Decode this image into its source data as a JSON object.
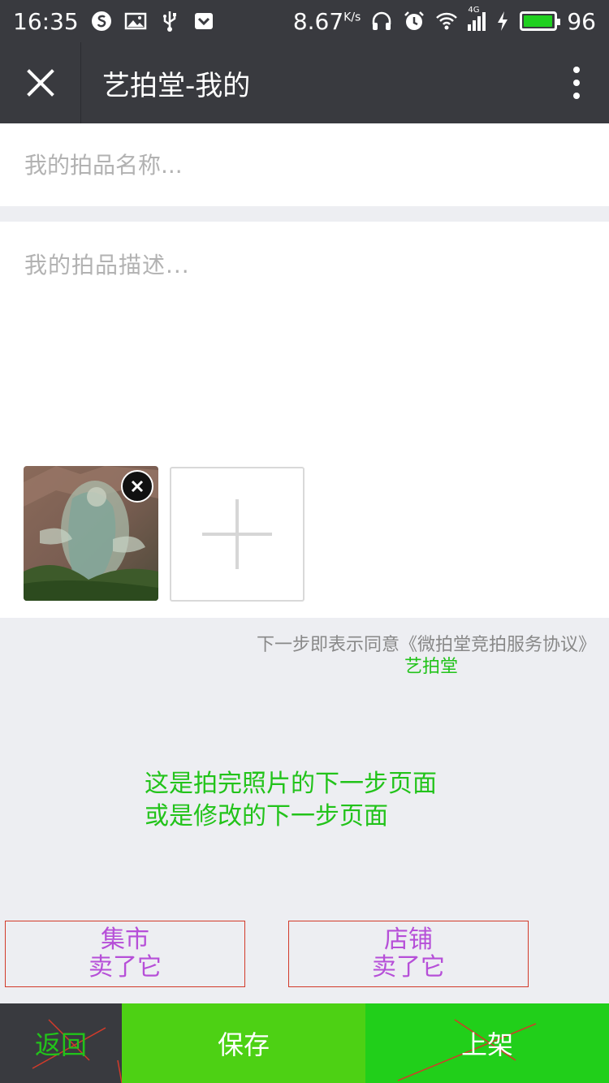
{
  "status_bar": {
    "time": "16:35",
    "speed_value": "8.67",
    "speed_unit": "K/s",
    "network": "4G",
    "battery_level": "96",
    "icons": [
      "s-icon",
      "image-icon",
      "usb-icon",
      "pocket-icon",
      "headphone-icon",
      "alarm-icon",
      "wifi-icon",
      "signal-icon",
      "charging-icon",
      "battery-icon"
    ]
  },
  "nav": {
    "close_icon": "close-icon",
    "title": "艺拍堂-我的",
    "more_icon": "more-vertical-icon"
  },
  "form": {
    "name_placeholder": "我的拍品名称...",
    "description_placeholder": "我的拍品描述...",
    "remove_photo_icon": "close-circle-icon",
    "add_photo_icon": "plus-icon"
  },
  "agreement": {
    "text": "下一步即表示同意《微拍堂竞拍服务协议》",
    "brand_annotation": "艺拍堂"
  },
  "note": {
    "line1": "这是拍完照片的下一步页面",
    "line2": "或是修改的下一步页面"
  },
  "sell_options": [
    {
      "line1": "集市",
      "line2": "卖了它"
    },
    {
      "line1": "店铺",
      "line2": "卖了它"
    }
  ],
  "bottom_bar": {
    "back_label": "返回",
    "save_label": "保存",
    "publish_label": "上架"
  },
  "colors": {
    "nav_bg": "#393a3f",
    "green": "#22c31a",
    "save_green": "#4dd114",
    "publish_green": "#21cf1a",
    "annotation_purple": "#b64fd8",
    "annotation_red": "#d23a2a"
  }
}
